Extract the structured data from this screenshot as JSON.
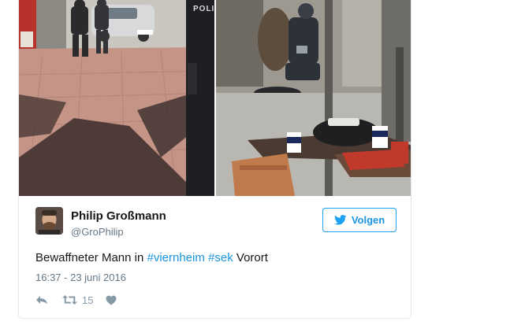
{
  "media": {
    "left_photo_text": "POLIZ"
  },
  "author": {
    "name": "Philip Großmann",
    "handle": "@GroPhilip"
  },
  "follow_button": {
    "label": "Volgen"
  },
  "tweet": {
    "text_before": "Bewaffneter Mann in ",
    "hashtag1": "#viernheim",
    "space": " ",
    "hashtag2": "#sek",
    "text_after": " Vorort"
  },
  "timestamp": "16:37 - 23 juni 2016",
  "actions": {
    "retweet_count": "15"
  },
  "colors": {
    "link": "#1b95e0",
    "twitter_blue": "#1da1f2",
    "muted": "#657786",
    "icon": "#8899a6"
  },
  "icons": {
    "follow": "twitter-bird-icon",
    "reply": "reply-icon",
    "retweet": "retweet-icon",
    "like": "heart-icon"
  }
}
